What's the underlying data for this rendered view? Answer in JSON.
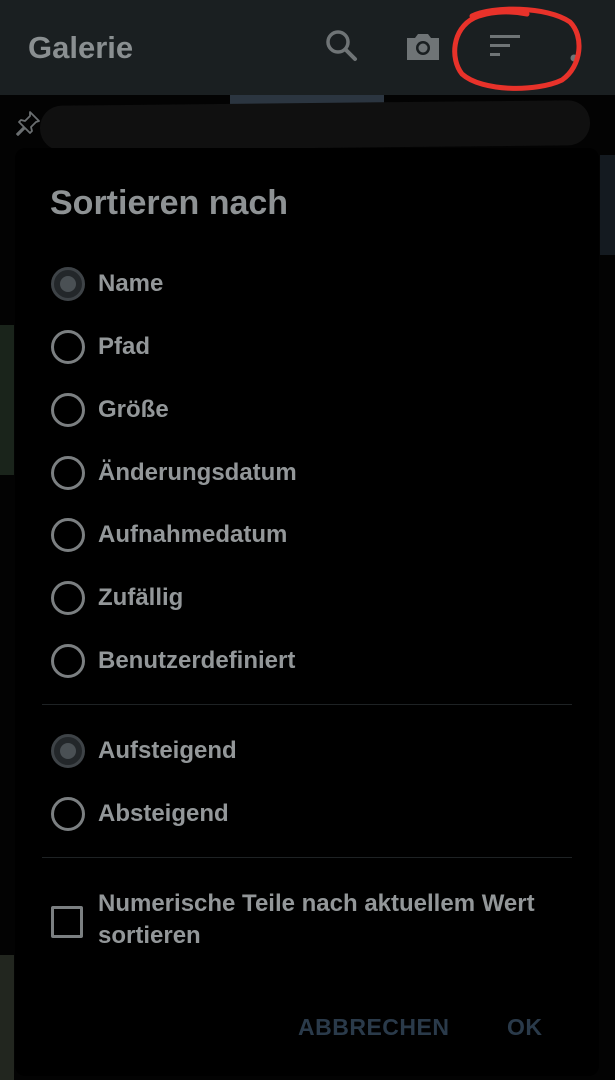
{
  "appbar": {
    "title": "Galerie",
    "icons": [
      "search-icon",
      "camera-icon",
      "sort-icon",
      "more-vert-icon"
    ]
  },
  "dialog": {
    "title": "Sortieren nach",
    "sort_options": [
      {
        "label": "Name",
        "checked": true
      },
      {
        "label": "Pfad",
        "checked": false
      },
      {
        "label": "Größe",
        "checked": false
      },
      {
        "label": "Änderungsdatum",
        "checked": false
      },
      {
        "label": "Aufnahmedatum",
        "checked": false
      },
      {
        "label": "Zufällig",
        "checked": false
      },
      {
        "label": "Benutzerdefiniert",
        "checked": false
      }
    ],
    "order_options": [
      {
        "label": "Aufsteigend",
        "checked": true
      },
      {
        "label": "Absteigend",
        "checked": false
      }
    ],
    "numeric_checkbox": {
      "label": "Numerische Teile nach aktuellem Wert sortieren",
      "checked": false
    },
    "cancel_label": "ABBRECHEN",
    "ok_label": "OK"
  },
  "colors": {
    "appbar": "#1a1f21",
    "annotation": "#e8322a",
    "button_text": "#2a3a4a"
  }
}
